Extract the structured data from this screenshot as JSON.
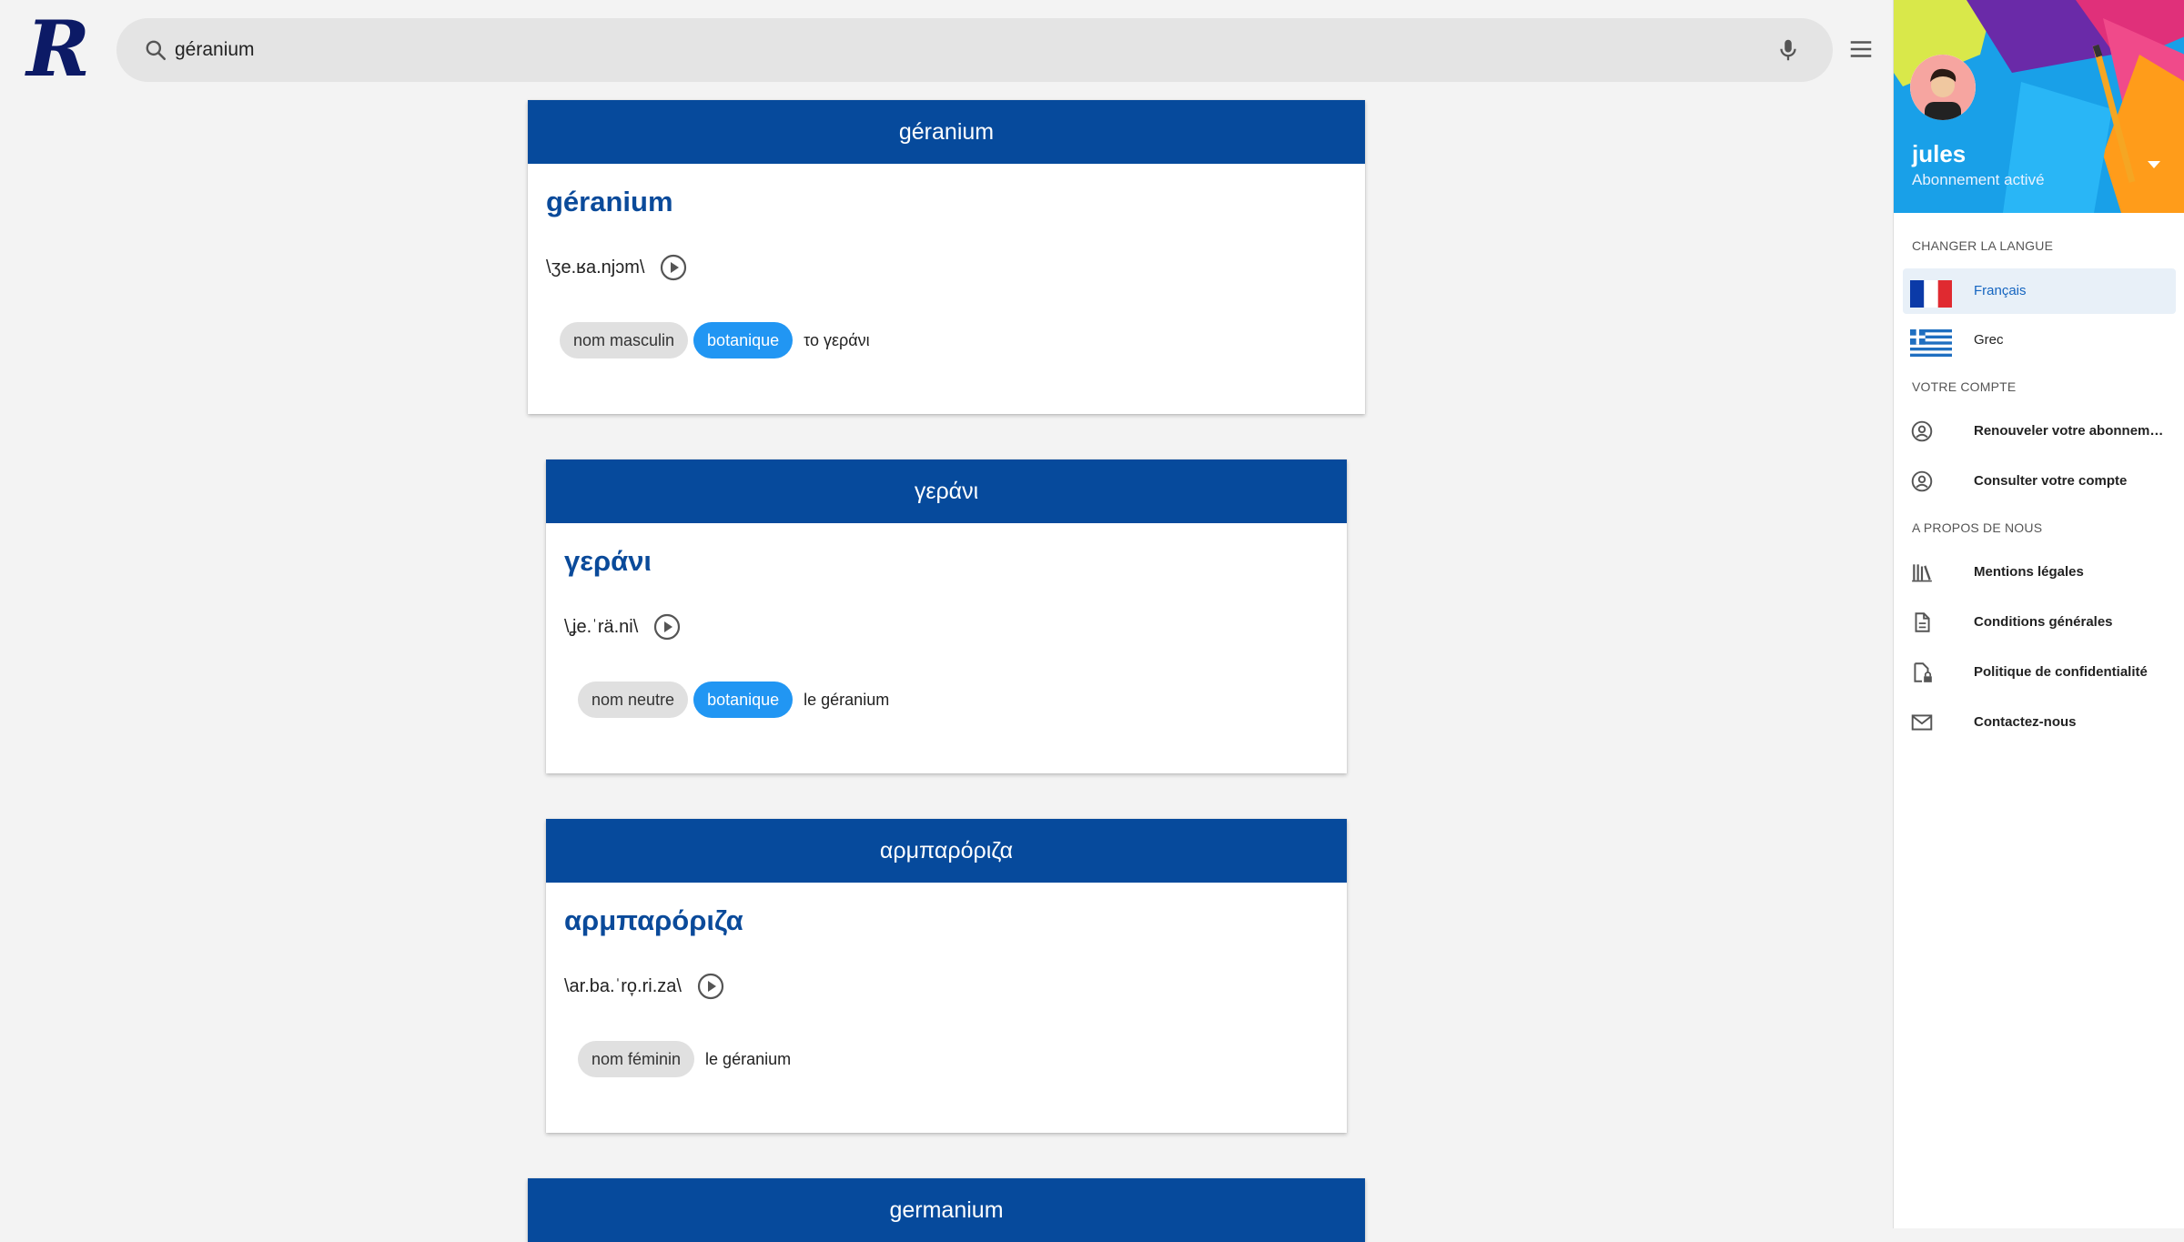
{
  "app": {
    "logo_text": "R"
  },
  "search": {
    "value": "géranium",
    "placeholder": ""
  },
  "entries": [
    {
      "header": "géranium",
      "headword": "géranium",
      "pron": "\\ʒe.ʁa.njɔm\\",
      "tags": [
        {
          "text": "nom masculin",
          "style": "grey"
        },
        {
          "text": "botanique",
          "style": "blue"
        }
      ],
      "translation": "το γεράνι"
    },
    {
      "header": "γεράνι",
      "headword": "γεράνι",
      "pron": "\\ʝe.ˈrä.ni\\",
      "tags": [
        {
          "text": "nom neutre",
          "style": "grey"
        },
        {
          "text": "botanique",
          "style": "blue"
        }
      ],
      "translation": "le géranium"
    },
    {
      "header": "αρμπαρόριζα",
      "headword": "αρμπαρόριζα",
      "pron": "\\ar.ba.ˈro̞.ri.za\\",
      "tags": [
        {
          "text": "nom féminin",
          "style": "grey"
        }
      ],
      "translation": "le géranium"
    },
    {
      "header": "germanium"
    }
  ],
  "user": {
    "name": "jules",
    "status": "Abonnement activé"
  },
  "sidebar": {
    "language_section": "CHANGER LA LANGUE",
    "languages": [
      {
        "label": "Français",
        "active": true
      },
      {
        "label": "Grec",
        "active": false
      }
    ],
    "account_section": "VOTRE COMPTE",
    "account_items": [
      {
        "label": "Renouveler votre abonnement",
        "icon": "account-refresh-icon"
      },
      {
        "label": "Consulter votre compte",
        "icon": "account-circle-icon"
      }
    ],
    "about_section": "A PROPOS DE NOUS",
    "about_items": [
      {
        "label": "Mentions légales",
        "icon": "library-icon"
      },
      {
        "label": "Conditions générales",
        "icon": "document-icon"
      },
      {
        "label": "Politique de confidentialité",
        "icon": "file-lock-icon"
      },
      {
        "label": "Contactez-nous",
        "icon": "mail-icon"
      }
    ]
  },
  "colors": {
    "header_blue": "#064a9c",
    "headword_blue": "#0a4a9a",
    "chip_blue": "#2196f3",
    "chip_grey": "#e0e0e0"
  }
}
